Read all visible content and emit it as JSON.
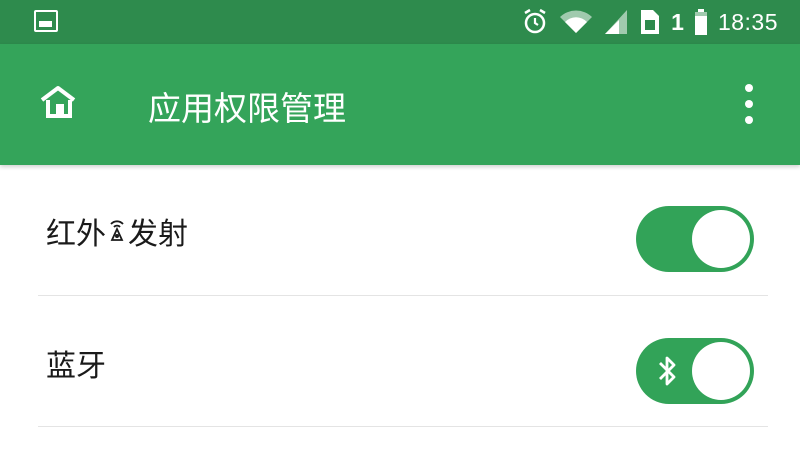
{
  "status_bar": {
    "time": "18:35",
    "sim_number": "1",
    "icons": [
      "notification-icon",
      "alarm-icon",
      "wifi-icon",
      "signal-icon",
      "sim-icon",
      "battery-icon"
    ]
  },
  "app_bar": {
    "title": "应用权限管理",
    "home_icon": "home-icon",
    "more_icon": "more-vertical-icon"
  },
  "permissions": [
    {
      "label_before": "红外",
      "label_after": "发射",
      "enabled": true
    },
    {
      "label_before": "蓝牙",
      "label_after": "",
      "enabled": true
    }
  ],
  "colors": {
    "status_bar": "#2e8b4d",
    "app_bar": "#34a45a",
    "toggle_on": "#32a358"
  }
}
